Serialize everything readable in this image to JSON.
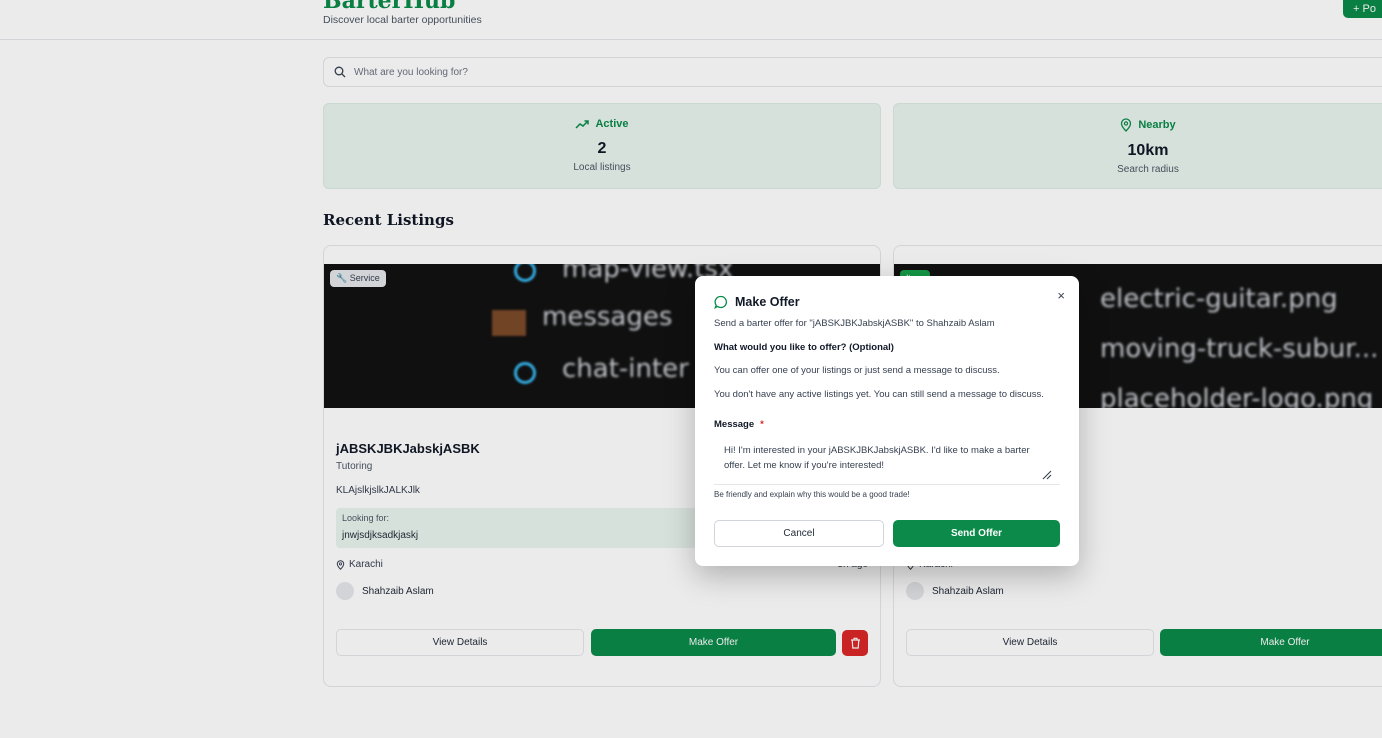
{
  "header": {
    "brand": "BarterHub",
    "tagline": "Discover local barter opportunities",
    "post_button": "+ Po"
  },
  "search": {
    "placeholder": "What are you looking for?"
  },
  "stats": [
    {
      "label": "Active",
      "value": "2",
      "sub": "Local listings",
      "icon": "trending-up-icon"
    },
    {
      "label": "Nearby",
      "value": "10km",
      "sub": "Search radius",
      "icon": "map-pin-icon"
    }
  ],
  "section_title": "Recent Listings",
  "listings": [
    {
      "badge": "Service",
      "image_text": [
        "map-view.tsx",
        "messages",
        "chat-inter"
      ],
      "title": "jABSKJBKJabskjASBK",
      "category": "Tutoring",
      "description": "KLAjslkjslkJALKJlk",
      "looking_for_label": "Looking for:",
      "looking_for": "jnwjsdjksadkjaskj",
      "location": "Karachi",
      "ago": "3h ago",
      "owner": "Shahzaib Aslam",
      "view_button": "View Details",
      "offer_button": "Make Offer"
    },
    {
      "badge": "Item",
      "image_text": [
        "electric-guitar.png",
        "moving-truck-subur...",
        "placeholder-logo.png"
      ],
      "location": "Karachi",
      "owner": "Shahzaib Aslam",
      "view_button": "View Details",
      "offer_button": "Make Offer"
    }
  ],
  "modal": {
    "title": "Make Offer",
    "subtitle": "Send a barter offer for \"jABSKJBKJabskjASBK\" to Shahzaib Aslam",
    "question": "What would you like to offer? (Optional)",
    "info1": "You can offer one of your listings or just send a message to discuss.",
    "info2": "You don't have any active listings yet. You can still send a message to discuss.",
    "message_label": "Message",
    "required_mark": "*",
    "message_value": "Hi! I'm interested in your jABSKJBKJabskjASBK. I'd like to make a barter offer. Let me know if you're interested!",
    "hint": "Be friendly and explain why this would be a good trade!",
    "cancel": "Cancel",
    "send": "Send Offer",
    "close": "×"
  },
  "colors": {
    "accent": "#0b8a4a",
    "danger": "#dc2626",
    "stat_bg": "#eaf5ef"
  }
}
